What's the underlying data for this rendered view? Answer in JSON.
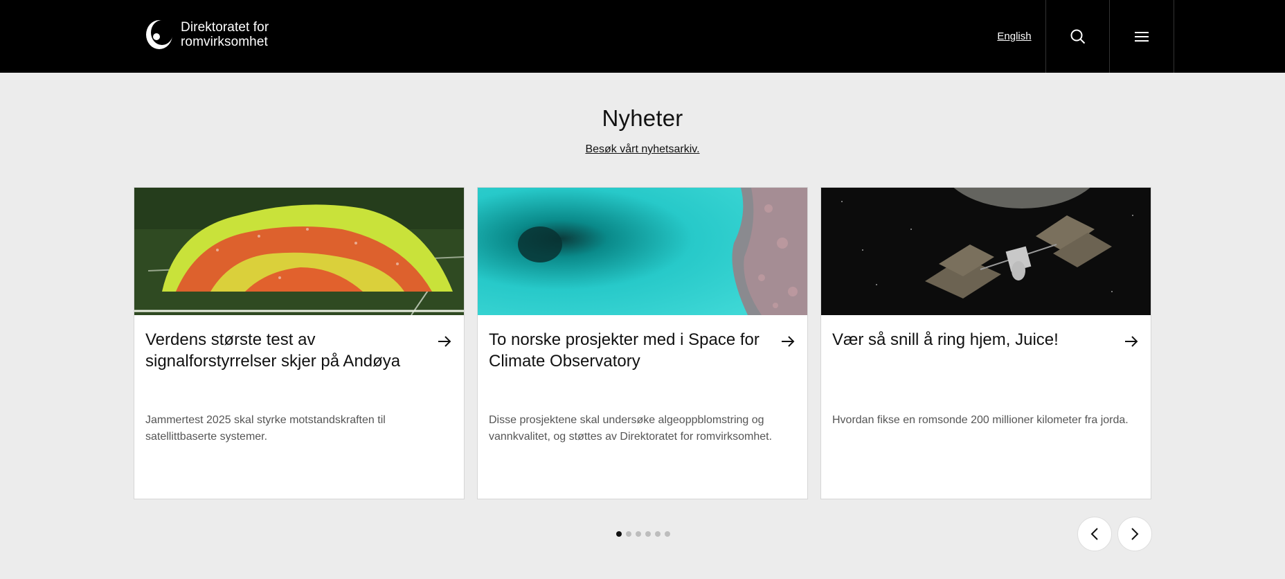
{
  "header": {
    "logo_line1": "Direktoratet for",
    "logo_line2": "romvirksomhet",
    "language_link": "English",
    "search_icon": "search-icon",
    "menu_icon": "hamburger-menu-icon"
  },
  "news": {
    "title": "Nyheter",
    "archive_link": "Besøk vårt nyhetsarkiv."
  },
  "cards": [
    {
      "title": "Verdens største test av signalforstyrrelser skjer på Andøya",
      "description": "Jammertest 2025 skal styrke motstandskraften til satellittbaserte systemer.",
      "image": "crowd-on-grass-photo"
    },
    {
      "title": "To norske prosjekter med i Space for Climate Observatory",
      "description": "Disse prosjektene skal undersøke algeoppblomstring og vannkvalitet, og støttes av Direktoratet for romvirksomhet.",
      "image": "satellite-image-algae-bloom"
    },
    {
      "title": "Vær så snill å ring hjem, Juice!",
      "description": "Hvordan fikse en romsonde 200 millioner kilometer fra jorda.",
      "image": "juice-spacecraft-illustration"
    }
  ],
  "carousel": {
    "total_slides": 6,
    "active_slide": 1,
    "prev_icon": "chevron-left-icon",
    "next_icon": "chevron-right-icon"
  },
  "colors": {
    "header_bg": "#000000",
    "page_bg": "#ececec",
    "card_bg": "#ffffff",
    "accent": "#111111"
  }
}
